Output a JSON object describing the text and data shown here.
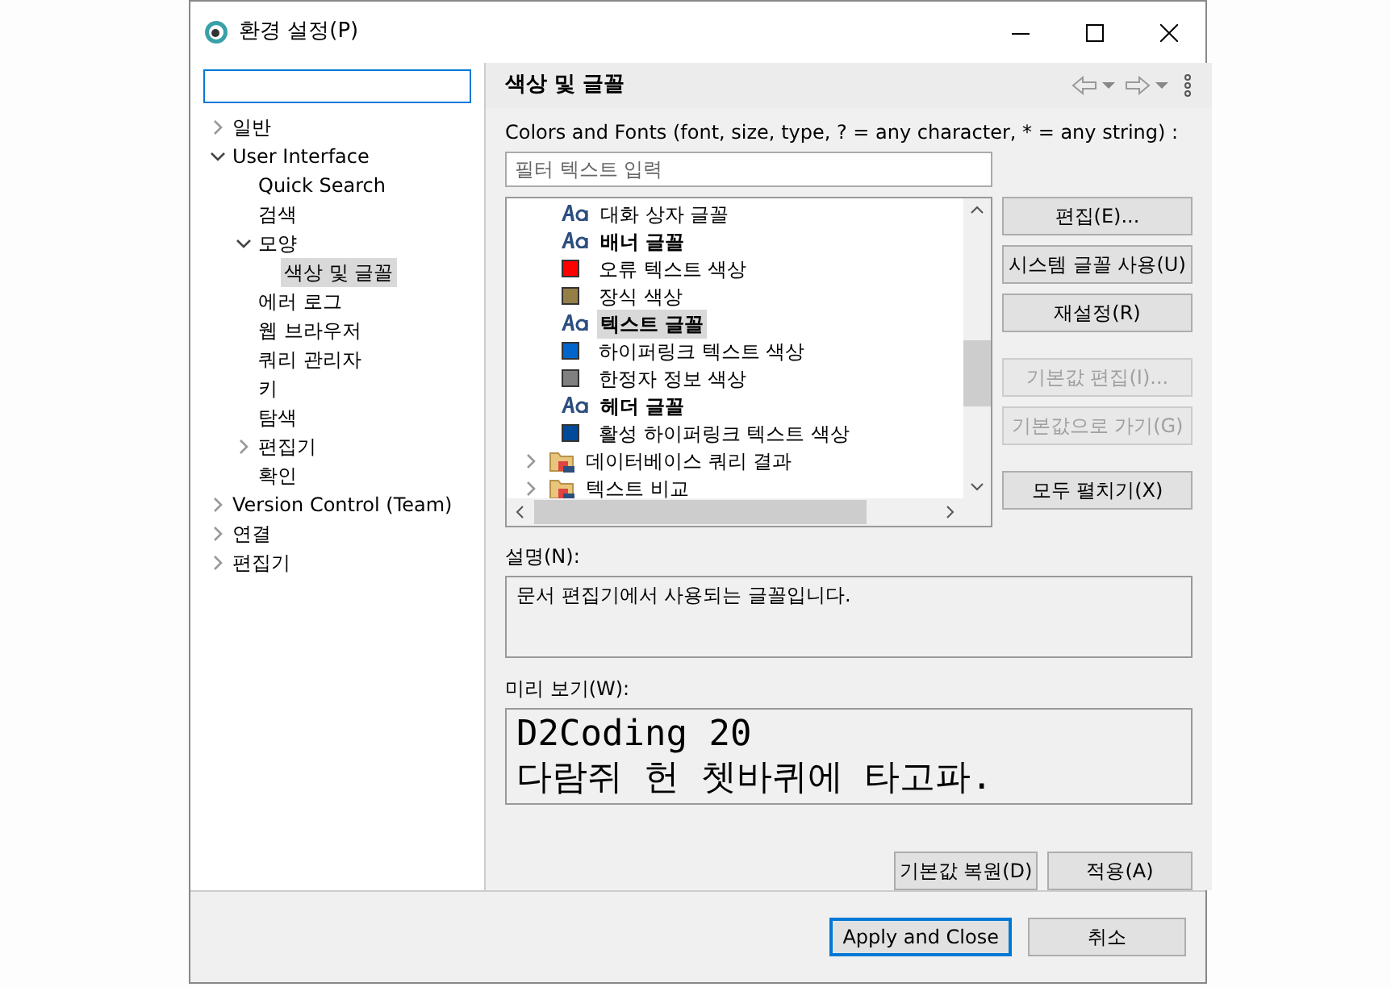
{
  "window": {
    "title": "환경 설정(P)"
  },
  "sidebar": {
    "items": [
      {
        "label": "일반",
        "expanded": false,
        "selected": false
      },
      {
        "label": "User Interface",
        "expanded": true,
        "selected": false,
        "children": [
          {
            "label": "Quick Search",
            "selected": false
          },
          {
            "label": "검색",
            "selected": false
          },
          {
            "label": "모양",
            "expanded": true,
            "selected": false,
            "children": [
              {
                "label": "색상 및 글꼴",
                "selected": true
              }
            ]
          },
          {
            "label": "에러 로그",
            "selected": false
          },
          {
            "label": "웹 브라우저",
            "selected": false
          },
          {
            "label": "쿼리 관리자",
            "selected": false
          },
          {
            "label": "키",
            "selected": false
          },
          {
            "label": "탐색",
            "selected": false
          },
          {
            "label": "편집기",
            "expanded": false,
            "selected": false
          },
          {
            "label": "확인",
            "selected": false
          }
        ]
      },
      {
        "label": "Version Control (Team)",
        "expanded": false,
        "selected": false
      },
      {
        "label": "연결",
        "expanded": false,
        "selected": false
      },
      {
        "label": "편집기",
        "expanded": false,
        "selected": false
      }
    ]
  },
  "page": {
    "title": "색상 및 글꼴",
    "filter_label": "Colors and Fonts (font, size, type, ? = any character, * = any string) :",
    "filter": {
      "placeholder": "필터 텍스트 입력"
    },
    "items": [
      {
        "kind": "font",
        "label": "대화 상자 글꼴",
        "bold": false,
        "selected": false
      },
      {
        "kind": "font",
        "label": "배너 글꼴",
        "bold": true,
        "selected": false
      },
      {
        "kind": "color",
        "label": "오류 텍스트 색상",
        "color": "#ff0000",
        "selected": false
      },
      {
        "kind": "color",
        "label": "장식 색상",
        "color": "#957f47",
        "selected": false
      },
      {
        "kind": "font",
        "label": "텍스트 글꼴",
        "bold": true,
        "selected": true
      },
      {
        "kind": "color",
        "label": "하이퍼링크 텍스트 색상",
        "color": "#0066cc",
        "selected": false
      },
      {
        "kind": "color",
        "label": "한정자 정보 색상",
        "color": "#808080",
        "selected": false
      },
      {
        "kind": "font",
        "label": "헤더 글꼴",
        "bold": true,
        "selected": false
      },
      {
        "kind": "color",
        "label": "활성 하이퍼링크 텍스트 색상",
        "color": "#004a99",
        "selected": false
      },
      {
        "kind": "category",
        "label": "데이터베이스 쿼리 결과",
        "expanded": false,
        "selected": false
      },
      {
        "kind": "category",
        "label": "텍스트 비교",
        "expanded": false,
        "selected": false
      }
    ],
    "side_buttons": [
      {
        "label": "편집(E)...",
        "disabled": false
      },
      {
        "label": "시스템 글꼴 사용(U)",
        "disabled": false
      },
      {
        "label": "재설정(R)",
        "disabled": false
      },
      {
        "label": "기본값 편집(I)...",
        "disabled": true
      },
      {
        "label": "기본값으로 가기(G)",
        "disabled": true
      },
      {
        "label": "모두 펼치기(X)",
        "disabled": false
      }
    ],
    "description_label": "설명(N):",
    "description": "문서 편집기에서 사용되는 글꼴입니다.",
    "preview_label": "미리 보기(W):",
    "preview": [
      "D2Coding 20",
      "다람쥐 헌 쳇바퀴에 타고파."
    ],
    "page_buttons": [
      "기본값 복원(D)",
      "적용(A)"
    ]
  },
  "dialog_buttons": [
    {
      "label": "Apply and Close",
      "default": true
    },
    {
      "label": "취소",
      "default": false
    }
  ]
}
